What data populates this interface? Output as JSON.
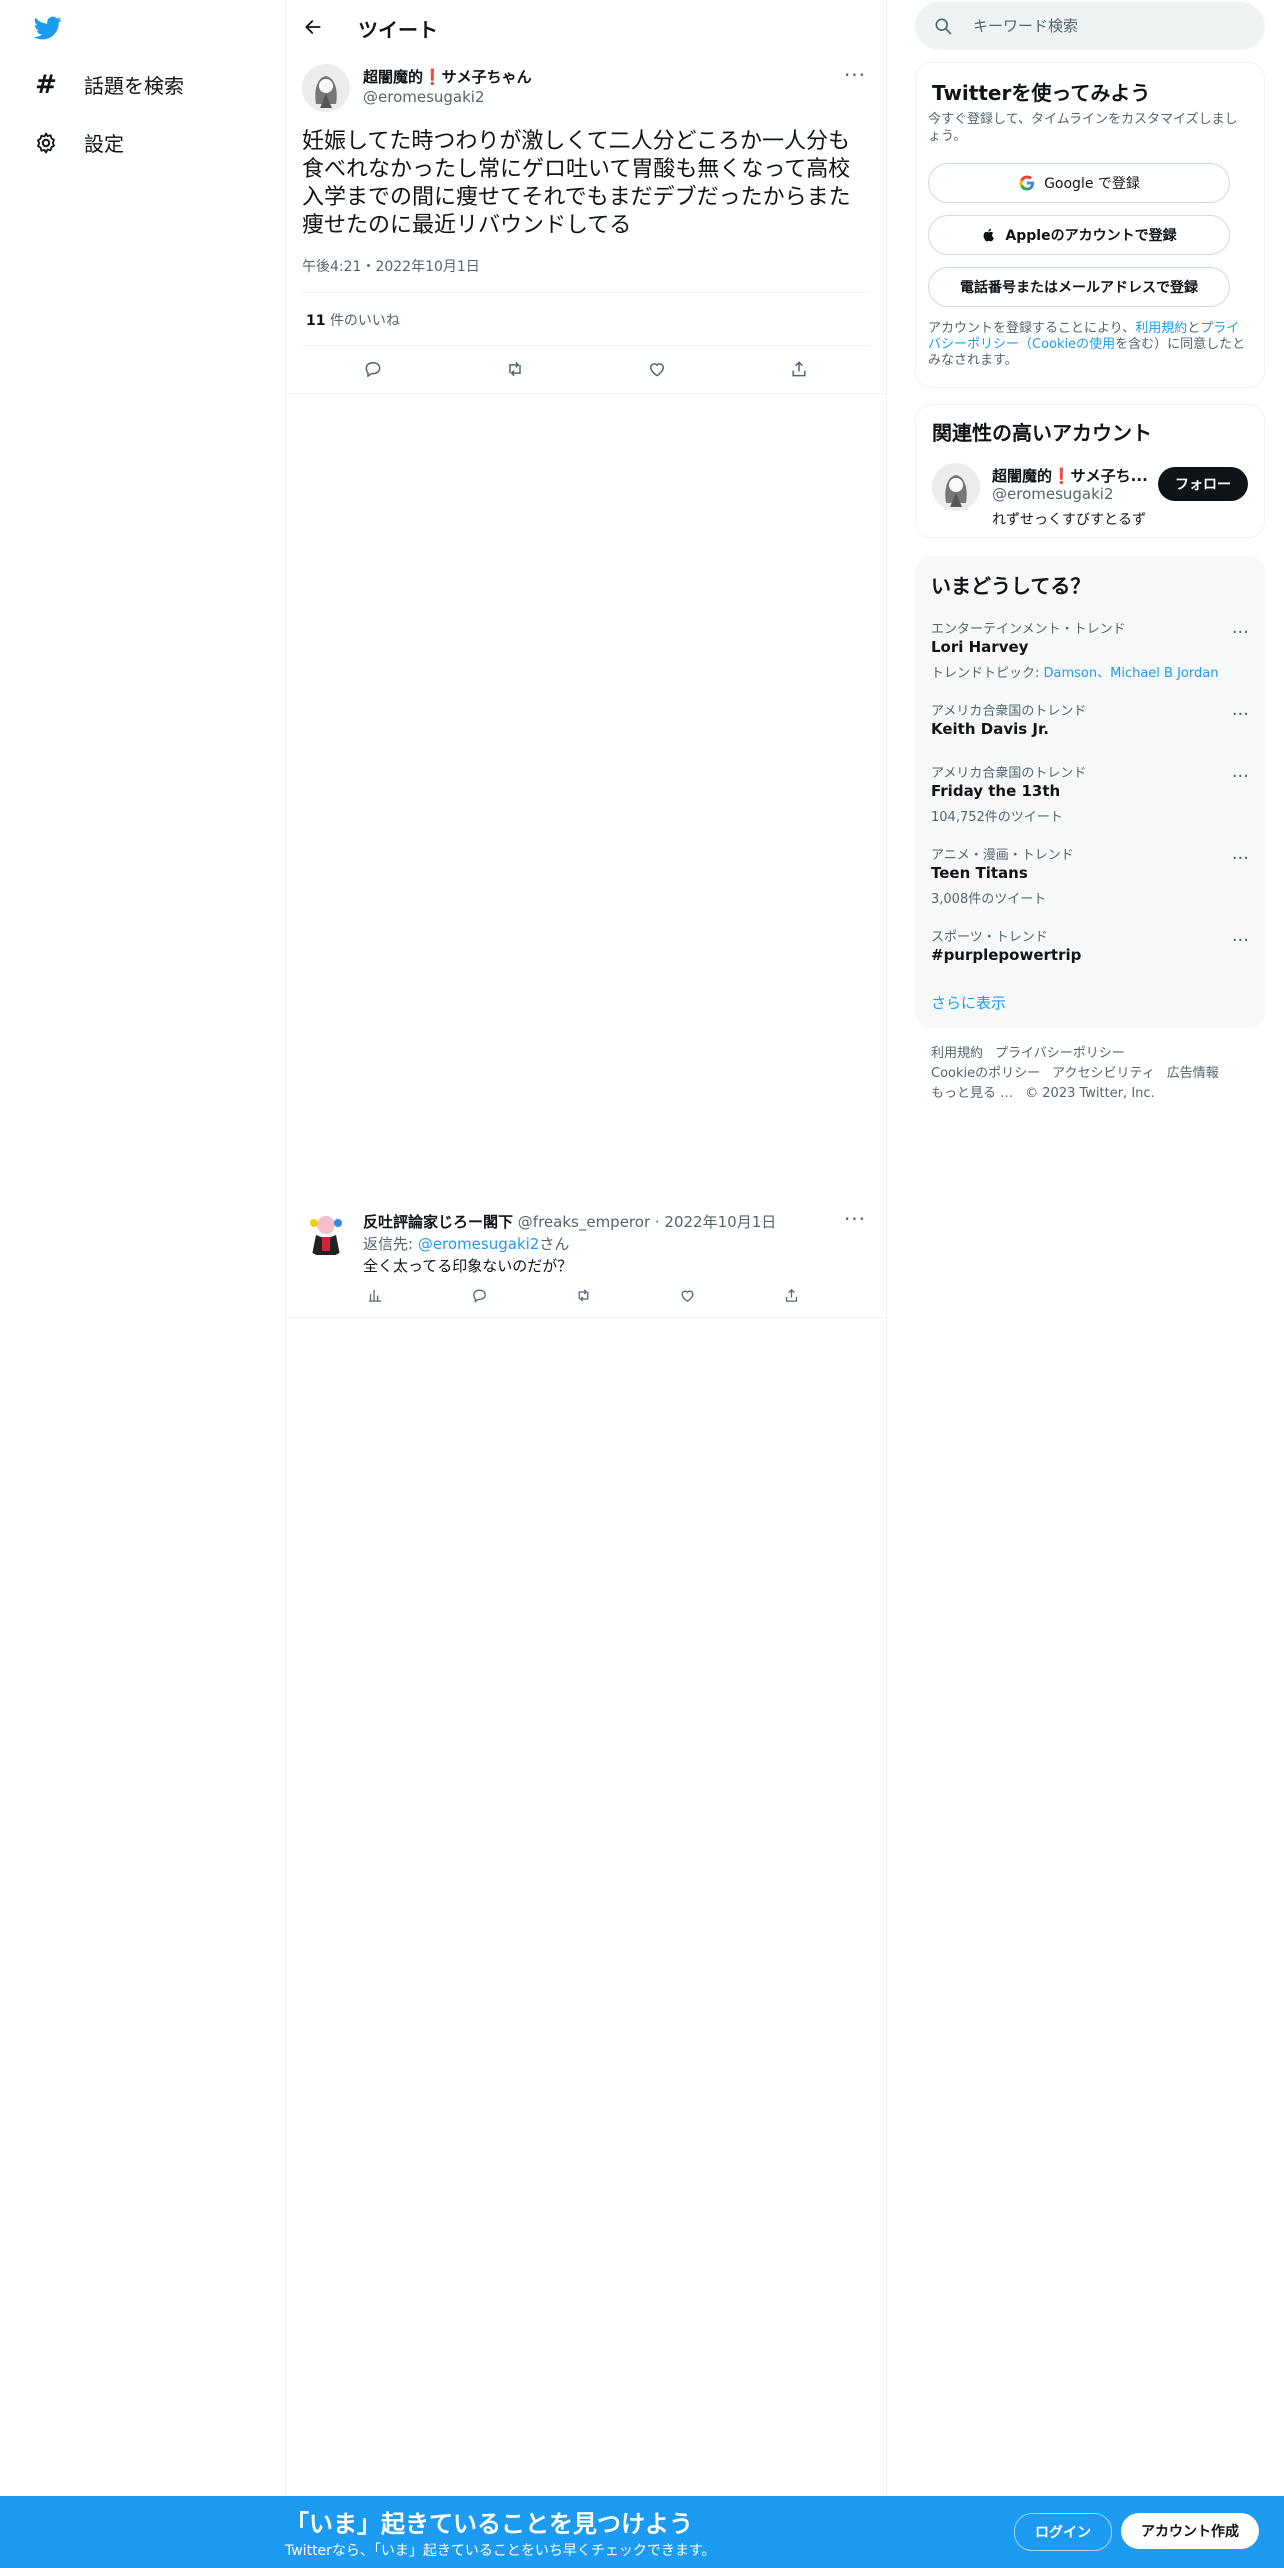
{
  "nav": {
    "items": [
      {
        "icon": "hashtag-icon",
        "label": "話題を検索"
      },
      {
        "icon": "gear-icon",
        "label": "設定"
      }
    ]
  },
  "header": {
    "title": "ツイート"
  },
  "tweet": {
    "author_name": "超闇魔的❗サメ子ちゃん",
    "author_handle": "@eromesugaki2",
    "text": "妊娠してた時つわりが激しくて二人分どころか一人分も食べれなかったし常にゲロ吐いて胃酸も無くなって高校入学までの間に痩せてそれでもまだデブだったからまた痩せたのに最近リバウンドしてる",
    "timestamp": "午後4:21・2022年10月1日",
    "likes_count": "11",
    "likes_label": "件のいいね"
  },
  "reply": {
    "author_name": "反吐評論家じろー閣下",
    "author_handle": "@freaks_emperor",
    "date": "· 2022年10月1日",
    "reply_to_prefix": "返信先: ",
    "reply_to_handle": "@eromesugaki2",
    "reply_to_suffix": "さん",
    "text": "全く太ってる印象ないのだが？"
  },
  "search": {
    "placeholder": "キーワード検索"
  },
  "signup_card": {
    "title": "Twitterを使ってみよう",
    "subtitle": "今すぐ登録して、タイムラインをカスタマイズしましょう。",
    "google_label": "Google で登録",
    "apple_label": "Appleのアカウントで登録",
    "phone_label": "電話番号またはメールアドレスで登録",
    "legal_prefix": "アカウントを登録することにより、",
    "legal_terms": "利用規約",
    "legal_and": "と",
    "legal_privacy": "プライバシーポリシー（Cookieの使用",
    "legal_suffix": "を含む）に同意したとみなされます。"
  },
  "relevant_card": {
    "title": "関連性の高いアカウント",
    "name": "超闇魔的❗サメ子ち...",
    "handle": "@eromesugaki2",
    "bio": "れずせっくすびすとるず",
    "follow_label": "フォロー"
  },
  "trends_card": {
    "title": "いまどうしてる？",
    "items": [
      {
        "category": "エンターテインメント・トレンド",
        "name": "Lori Harvey",
        "extra_prefix": "トレンドトピック: ",
        "extra_links": "Damson、Michael B Jordan"
      },
      {
        "category": "アメリカ合衆国のトレンド",
        "name": "Keith Davis Jr.",
        "extra": ""
      },
      {
        "category": "アメリカ合衆国のトレンド",
        "name": "Friday the 13th",
        "extra": "104,752件のツイート"
      },
      {
        "category": "アニメ・漫画・トレンド",
        "name": "Teen Titans",
        "extra": "3,008件のツイート"
      },
      {
        "category": "スポーツ・トレンド",
        "name": "#purplepowertrip",
        "extra": ""
      }
    ],
    "show_more": "さらに表示"
  },
  "footer": {
    "links": [
      "利用規約",
      "プライバシーポリシー",
      "Cookieのポリシー",
      "アクセシビリティ",
      "広告情報",
      "もっと見る …",
      "© 2023 Twitter, Inc."
    ]
  },
  "bottom_bar": {
    "title": "「いま」起きていることを見つけよう",
    "subtitle": "Twitterなら、「いま」起きていることをいち早くチェックできます。",
    "login_label": "ログイン",
    "signup_label": "アカウント作成"
  },
  "colors": {
    "accent": "#1d9bf0",
    "text": "#0f1419",
    "muted": "#536471",
    "border": "#eff3f4"
  }
}
